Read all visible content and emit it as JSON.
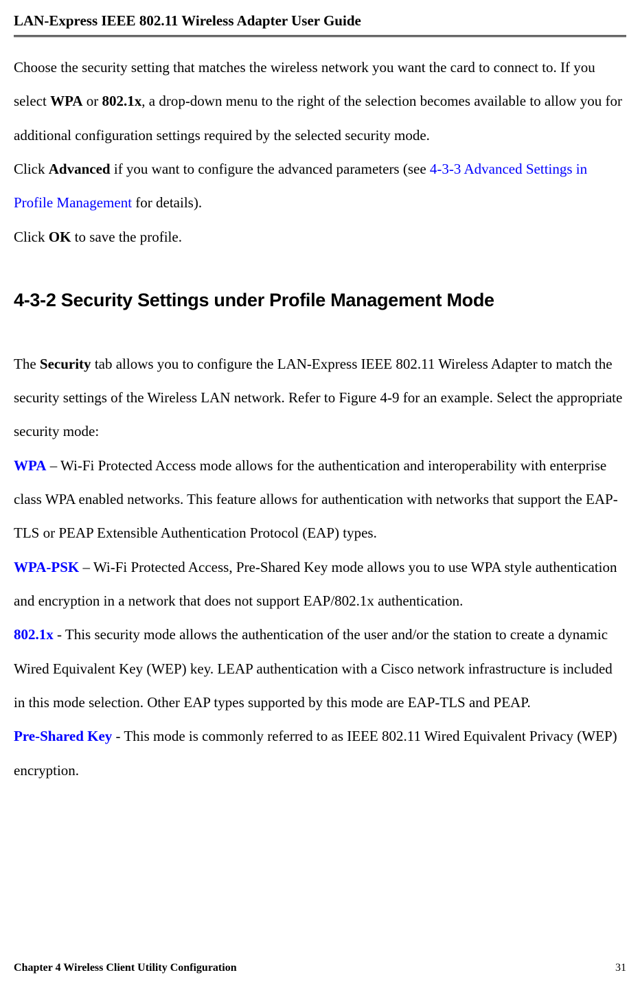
{
  "header": {
    "title": "LAN-Express IEEE 802.11 Wireless Adapter User Guide"
  },
  "content": {
    "para1_part1": "Choose the security setting that matches the wireless network you want the card to connect to. If you select ",
    "para1_bold1": "WPA",
    "para1_part2": " or ",
    "para1_bold2": "802.1x",
    "para1_part3": ", a drop-down menu to the right of the selection becomes available to allow you for additional configuration settings required by the selected security mode.",
    "para2_part1": "Click ",
    "para2_bold1": "Advanced",
    "para2_part2": " if you want to configure the advanced parameters (see ",
    "para2_link": "4-3-3 Advanced Settings in Profile Management",
    "para2_part3": " for details).",
    "para3_part1": "Click ",
    "para3_bold1": "OK",
    "para3_part2": " to save the profile.",
    "section_heading": "4-3-2 Security Settings under Profile Management Mode",
    "para4_part1": "The ",
    "para4_bold1": "Security",
    "para4_part2": " tab allows you to configure the LAN-Express IEEE 802.11 Wireless Adapter to match the security settings of the Wireless LAN network. Refer to Figure 4-9 for an example. Select the appropriate security mode:",
    "wpa_label": "WPA",
    "wpa_text": " – Wi-Fi Protected Access mode allows for the authentication and interoperability with enterprise class WPA enabled networks. This feature allows for authentication with networks that support the EAP-TLS or PEAP Extensible Authentication Protocol (EAP) types.",
    "wpapsk_label": "WPA-PSK",
    "wpapsk_text": " – Wi-Fi Protected Access, Pre-Shared Key mode allows you to use WPA style authentication and encryption in a network that does not support EAP/802.1x authentication.",
    "mode8021x_label": "802.1x",
    "mode8021x_text": " - This security mode allows the authentication of the user and/or the station to create a dynamic Wired Equivalent Key (WEP) key. LEAP authentication with a Cisco network infrastructure is included in this mode selection. Other EAP types supported by this mode are EAP-TLS and PEAP.",
    "psk_label": "Pre-Shared Key",
    "psk_text": " - This mode is commonly referred to as IEEE 802.11 Wired Equivalent Privacy (WEP) encryption."
  },
  "footer": {
    "left": "Chapter 4 Wireless Client Utility Configuration",
    "right": "31"
  }
}
